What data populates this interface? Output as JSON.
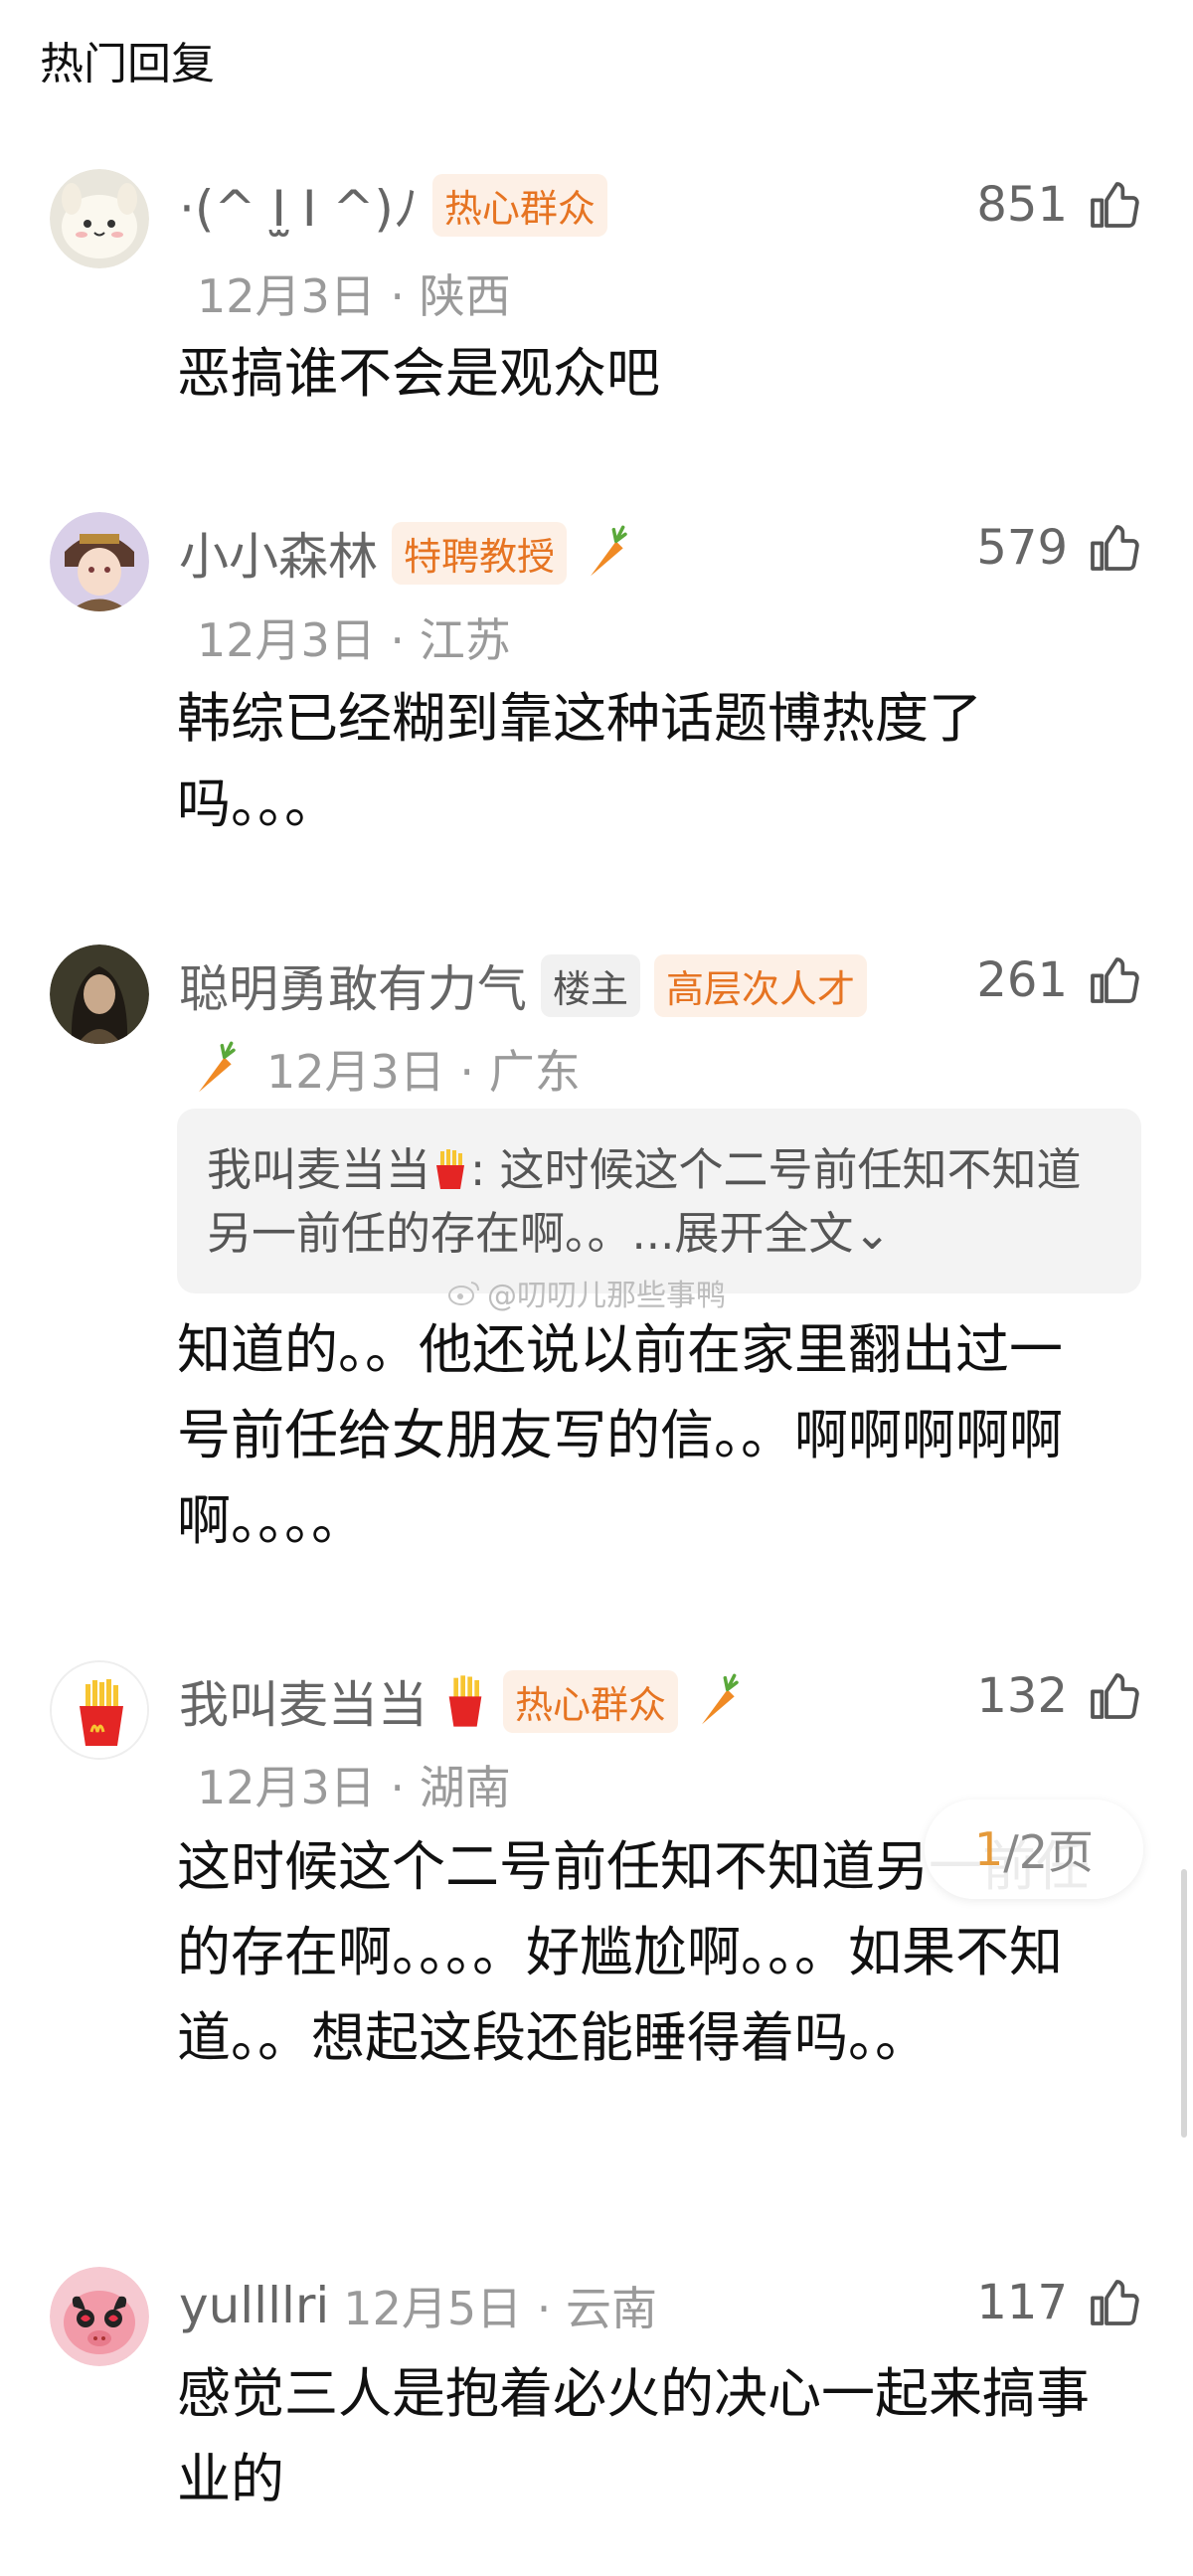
{
  "section_title": "热门回复",
  "comments": [
    {
      "username": "·(^ I̫ I ^)ﾉ",
      "badges": [
        "热心群众"
      ],
      "date": "12月3日",
      "location": "陕西",
      "likes": "851",
      "text": "恶搞谁不会是观众吧"
    },
    {
      "username": "小小森林",
      "badges": [
        "特聘教授"
      ],
      "date": "12月3日",
      "location": "江苏",
      "likes": "579",
      "text": "韩综已经糊到靠这种话题博热度了吗。。。"
    },
    {
      "username": "聪明勇敢有力气",
      "badges": [
        "楼主",
        "高层次人才"
      ],
      "date": "12月3日",
      "location": "广东",
      "likes": "261",
      "quote_user": "我叫麦当当",
      "quote_text": ": 这时候这个二号前任知不知道另一前任的存在啊。。...",
      "quote_expand": "展开全文⌄",
      "text": "知道的。。他还说以前在家里翻出过一号前任给女朋友写的信。。啊啊啊啊啊啊。。。。"
    },
    {
      "username": "我叫麦当当",
      "badges": [
        "热心群众"
      ],
      "date": "12月3日",
      "location": "湖南",
      "likes": "132",
      "text": "这时候这个二号前任知不知道另一前任的存在啊。。。。好尴尬啊。。。如果不知道。。想起这段还能睡得着吗。。"
    },
    {
      "username": "yullllri",
      "badges": [],
      "date": "12月5日",
      "location": "云南",
      "likes": "117",
      "text": "感觉三人是抱着必火的决心一起来搞事业的"
    }
  ],
  "watermark": "@叨叨儿那些事鸭",
  "pager": {
    "current": "1",
    "rest": "/2页"
  },
  "colors": {
    "badge_orange": "#e67422",
    "badge_bg": "#fdf0e6",
    "meta_gray": "#9a9a9a",
    "username_gray": "#666666"
  }
}
